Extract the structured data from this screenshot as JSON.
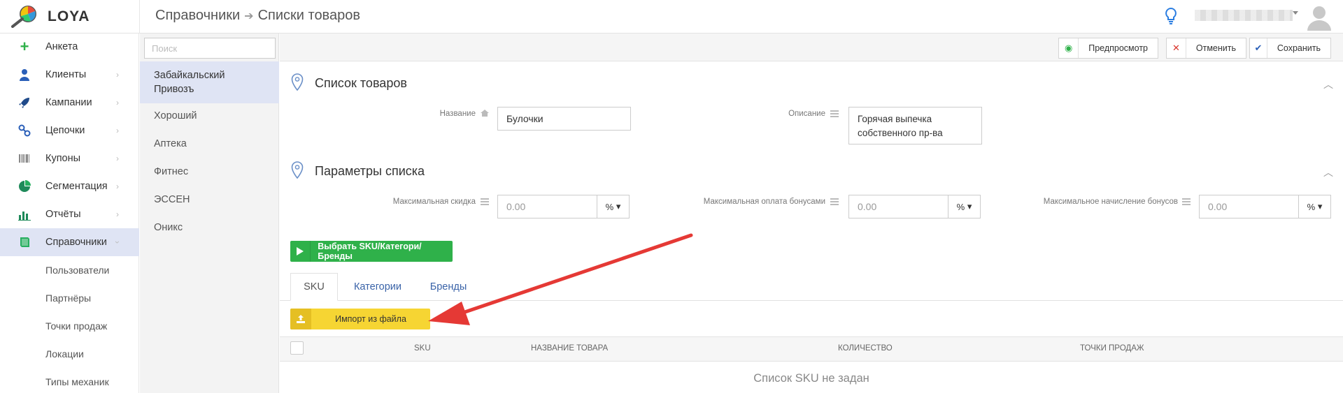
{
  "header": {
    "logo_text": "LOYA",
    "breadcrumb": [
      "Справочники",
      "Списки товаров"
    ]
  },
  "sidebar": {
    "items": [
      {
        "label": "Анкета",
        "icon": "plus-icon"
      },
      {
        "label": "Клиенты",
        "icon": "user-icon"
      },
      {
        "label": "Кампании",
        "icon": "rocket-icon"
      },
      {
        "label": "Цепочки",
        "icon": "chain-icon"
      },
      {
        "label": "Купоны",
        "icon": "barcode-icon"
      },
      {
        "label": "Сегментация",
        "icon": "pie-icon"
      },
      {
        "label": "Отчёты",
        "icon": "bar-chart-icon"
      },
      {
        "label": "Справочники",
        "icon": "book-icon"
      }
    ],
    "subitems": [
      "Пользователи",
      "Партнёры",
      "Точки продаж",
      "Локации",
      "Типы механик"
    ]
  },
  "list": {
    "search_placeholder": "Поиск",
    "items": [
      "Забайкальский Привозъ",
      "Хороший",
      "Аптека",
      "Фитнес",
      "ЭССЕН",
      "Оникс"
    ]
  },
  "toolbar": {
    "preview": "Предпросмотр",
    "cancel": "Отменить",
    "save": "Сохранить"
  },
  "section1": {
    "title": "Список товаров",
    "name_label": "Название",
    "name_value": "Булочки",
    "desc_label": "Описание",
    "desc_line1": "Горячая выпечка",
    "desc_line2": "собственного пр-ва"
  },
  "section2": {
    "title": "Параметры списка",
    "max_discount_label": "Максимальная скидка",
    "max_discount_value": "0.00",
    "max_bonus_pay_label": "Максимальная оплата бонусами",
    "max_bonus_pay_value": "0.00",
    "max_bonus_accrual_label": "Максимальное начисление бонусов",
    "max_bonus_accrual_value": "0.00",
    "unit": "%"
  },
  "select_button": "Выбрать SKU/Категори/Бренды",
  "tabs": [
    "SKU",
    "Категории",
    "Бренды"
  ],
  "import_button": "Импорт из файла",
  "table": {
    "columns": [
      "SKU",
      "Название товара",
      "Количество",
      "Точки продаж"
    ],
    "empty": "Список SKU не задан"
  },
  "colors": {
    "accent_active": "#dfe4f4",
    "green": "#2fb14a",
    "yellow": "#f6d533",
    "link": "#3a63a8",
    "arrow": "#e53935"
  }
}
